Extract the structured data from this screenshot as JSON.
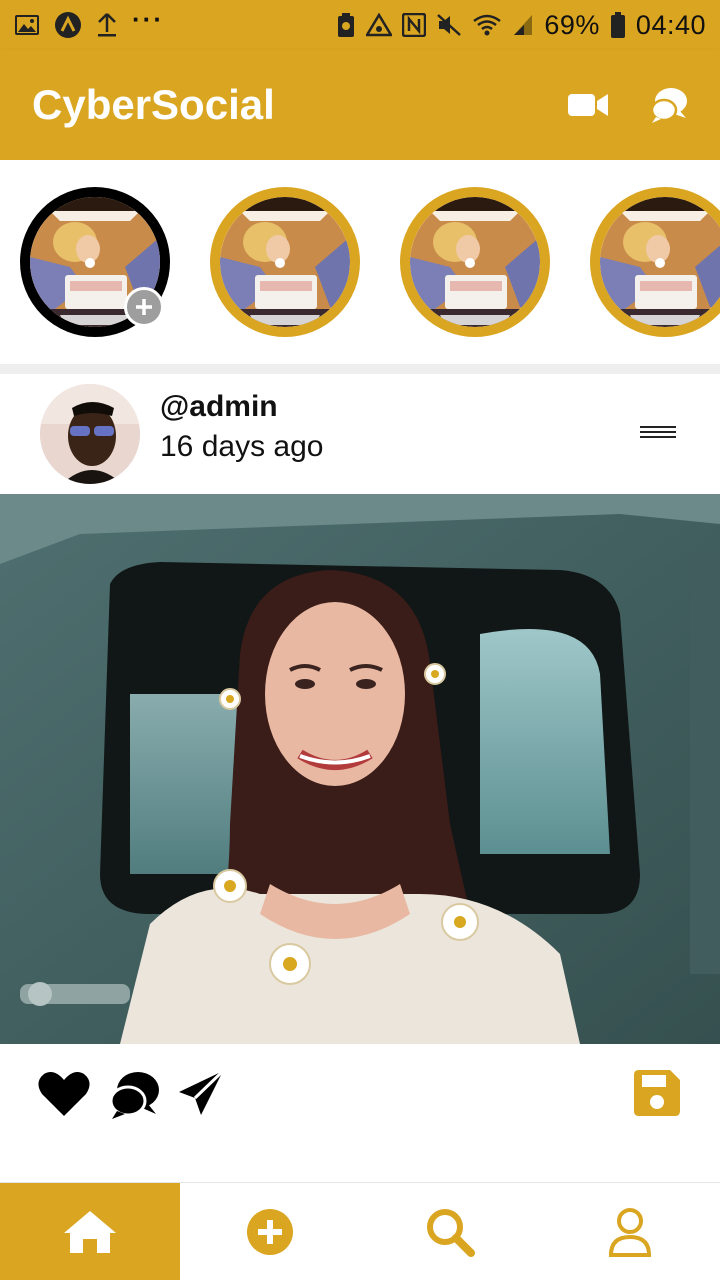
{
  "status_bar": {
    "icons_left": [
      "gallery-icon",
      "app-a-icon",
      "upload-icon",
      "more-dots-icon"
    ],
    "more": "···",
    "icons_right": [
      "battery-saver-icon",
      "warning-icon",
      "nfc-icon",
      "mute-icon",
      "wifi-icon",
      "signal-icon"
    ],
    "battery": "69%",
    "time": "04:40"
  },
  "app_bar": {
    "title": "CyberSocial",
    "actions": [
      "video-camera-icon",
      "chat-bubbles-icon"
    ]
  },
  "stories": {
    "items": [
      {
        "type": "own",
        "has_add_badge": true
      },
      {
        "type": "friend"
      },
      {
        "type": "friend"
      },
      {
        "type": "friend"
      }
    ]
  },
  "post": {
    "username": "@admin",
    "time": "16 days ago",
    "actions": [
      "heart-icon",
      "comment-icon",
      "send-icon",
      "save-icon"
    ]
  },
  "bottom_nav": {
    "items": [
      "home-icon",
      "add-circle-icon",
      "search-icon",
      "profile-icon"
    ],
    "active": "home-icon"
  },
  "colors": {
    "accent": "#DAA520",
    "own_story_ring": "#000000",
    "nav_active_bg": "#DAA520",
    "icon_dark": "#000000"
  }
}
